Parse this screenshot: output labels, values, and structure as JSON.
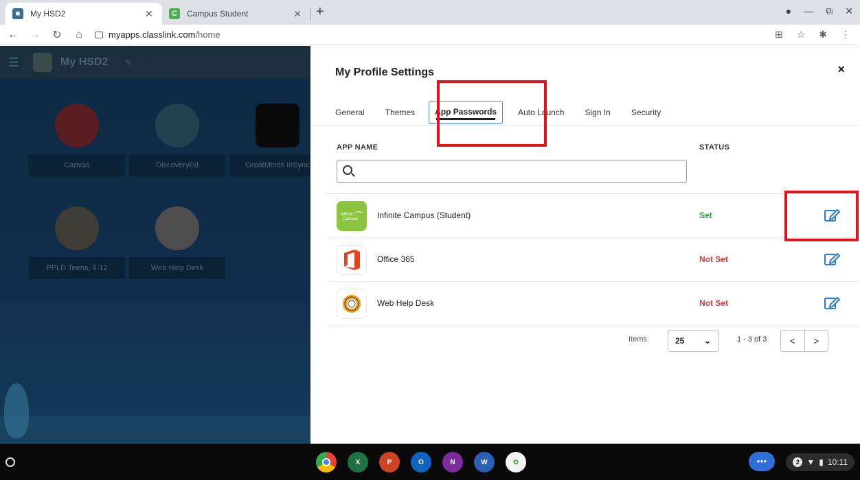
{
  "browser": {
    "tabs": [
      {
        "title": "My HSD2",
        "favicon": "classlink-favicon"
      },
      {
        "title": "Campus Student",
        "favicon": "campus-favicon"
      }
    ],
    "new_tab_label": "+",
    "url_host": "myapps.classlink.com",
    "url_path": "/home"
  },
  "background_page": {
    "title": "My HSD2",
    "apps": [
      {
        "label": "Canvas",
        "color": "#c6202e"
      },
      {
        "label": "DiscoveryEd",
        "color": "#1f6a8a"
      },
      {
        "label": "GreatMinds InSync",
        "color": "#111111"
      },
      {
        "label": "PPLD Teens, 6-12",
        "color": "#7a7566"
      },
      {
        "label": "Web Help Desk",
        "color": "#d8d8d8"
      }
    ]
  },
  "panel": {
    "title": "My Profile Settings",
    "close_label": "×",
    "tabs": [
      "General",
      "Themes",
      "App Passwords",
      "Auto Launch",
      "Sign In",
      "Security"
    ],
    "active_tab": "App Passwords",
    "col_app_name": "APP NAME",
    "col_status": "STATUS",
    "search": {
      "value": "",
      "placeholder": ""
    },
    "rows": [
      {
        "name": "Infinite Campus (Student)",
        "status": "Set",
        "status_color": "#2e9b46",
        "icon": "infinite-campus-icon"
      },
      {
        "name": "Office 365",
        "status": "Not Set",
        "status_color": "#d83b3b",
        "icon": "office365-icon"
      },
      {
        "name": "Web Help Desk",
        "status": "Not Set",
        "status_color": "#d83b3b",
        "icon": "web-help-desk-icon"
      }
    ],
    "pager": {
      "items_label": "Items:",
      "items_value": "25",
      "range": "1 - 3 of 3",
      "prev": "<",
      "next": ">"
    },
    "accent_color": "#4285f4",
    "edit_icon_color": "#2979d8"
  },
  "shelf": {
    "time": "10:11",
    "notification_count": "2"
  }
}
